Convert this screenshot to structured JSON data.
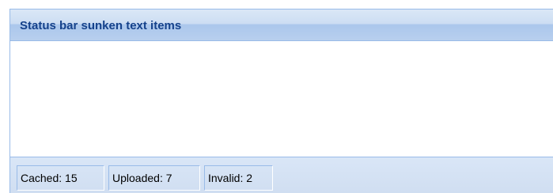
{
  "panel": {
    "title": "Status bar sunken text items"
  },
  "statusbar": {
    "items": [
      {
        "label": "Cached: 15"
      },
      {
        "label": "Uploaded: 7"
      },
      {
        "label": "Invalid: 2"
      }
    ]
  }
}
